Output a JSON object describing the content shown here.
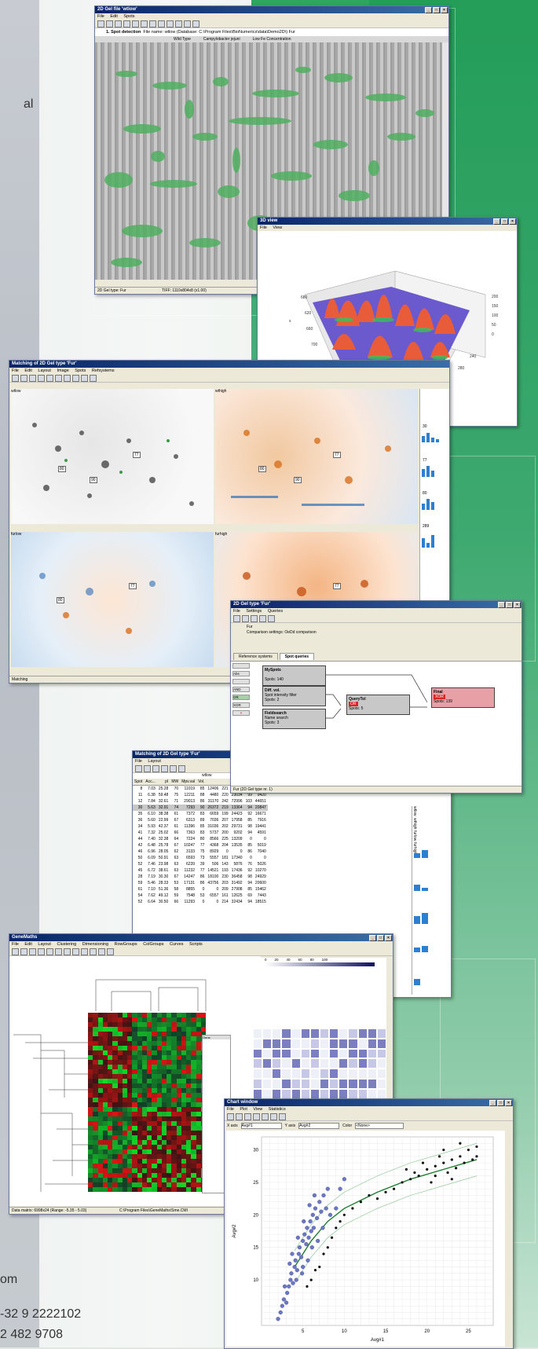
{
  "side_text": {
    "l1": "al",
    "l2": "om",
    "phone1": "-32 9 2222102",
    "phone2": "2 482 9708"
  },
  "gel_window": {
    "title": "2D Gel file 'wtlow'",
    "menu": [
      "File",
      "Edit",
      "Spots"
    ],
    "step": "1. Spot detection",
    "file_info": "File name: wtlow (Database: C:\\Program Files\\BioNumerics\\data\\Demo2D\\) Fur",
    "tabs": [
      "Wild Type",
      "Campylobacter jejuni",
      "Low Fe Concentration"
    ],
    "status_left": "2D Gel type: Fur",
    "status_right": "TIFF: 1110x804x8 (x1.00)"
  },
  "view3d": {
    "title": "3D view",
    "menu": [
      "File",
      "View"
    ],
    "y_ticks": [
      "200",
      "150",
      "100",
      "50",
      "0"
    ],
    "x_ticks": [
      "240",
      "280",
      "300",
      "320",
      "340",
      "260"
    ],
    "z_ticks": [
      "680",
      "620",
      "660",
      "700",
      "760"
    ],
    "axis_x": "x",
    "axis_y": "y"
  },
  "matching_window": {
    "title": "Matching of 2D Gel type 'Fur'",
    "menu": [
      "File",
      "Edit",
      "Layout",
      "Image",
      "Spots",
      "Refsystems"
    ],
    "panels": [
      "wtlow",
      "wthigh",
      "furlow",
      "furhigh"
    ],
    "spot_labels": [
      "77",
      "80",
      "90"
    ],
    "side_values": [
      "30",
      "77",
      "80",
      "289"
    ],
    "status": "Matching"
  },
  "query_window": {
    "title": "2D Gel type 'Fur'",
    "menu": [
      "File",
      "Settings",
      "Queries"
    ],
    "name": "Fur",
    "settings": "Comparison settings: OeDd comparison",
    "tabs": [
      "Reference systems",
      "Spot queries"
    ],
    "boxes": {
      "myspots": {
        "title": "MySpots",
        "sub": "Spots: 140"
      },
      "diff": {
        "title": "Diff. vol.",
        "sub1": "Spot intensity filter",
        "sub2": "Spots: 2"
      },
      "field": {
        "title": "Fieldsearch",
        "sub1": "Name search",
        "sub2": "Spots: 3"
      },
      "query": {
        "title": "QueryTol",
        "op": "OR",
        "sub": "Spots: 5"
      },
      "final": {
        "title": "Final",
        "op": "XOR",
        "sub": "Spots: 139"
      }
    },
    "left_btns": [
      "Abs",
      "AND",
      "OR",
      "XOR"
    ],
    "status": "Fur (2D Gel type nr. 1)"
  },
  "table_window": {
    "title": "Matching of 2D Gel type 'Fur'",
    "menu": [
      "File",
      "Layout"
    ],
    "group": "wtlow",
    "headers": [
      "Spot",
      "Acc...",
      "pI",
      "MW",
      "Mpv.val",
      "Vol.",
      "",
      "",
      "",
      "",
      ""
    ],
    "rows": [
      [
        "8",
        "7.03",
        "25.28",
        "70",
        "11019",
        "85",
        "12406",
        "221",
        "20874",
        "97",
        "11528"
      ],
      [
        "11",
        "6.38",
        "59.48",
        "75",
        "12211",
        "88",
        "4480",
        "220",
        "23034",
        "99",
        "9420"
      ],
      [
        "12",
        "7.84",
        "32.61",
        "71",
        "29013",
        "86",
        "31170",
        "242",
        "72996",
        "103",
        "44651"
      ],
      [
        "30",
        "5.63",
        "32.91",
        "74",
        "7293",
        "90",
        "26372",
        "219",
        "13364",
        "94",
        "20847"
      ],
      [
        "35",
        "6.10",
        "38.38",
        "61",
        "7372",
        "83",
        "6659",
        "199",
        "24423",
        "92",
        "16671"
      ],
      [
        "36",
        "5.60",
        "22.99",
        "67",
        "6313",
        "89",
        "7036",
        "207",
        "17958",
        "85",
        "7916"
      ],
      [
        "34",
        "5.93",
        "42.37",
        "61",
        "11396",
        "85",
        "31036",
        "202",
        "29731",
        "98",
        "19441"
      ],
      [
        "41",
        "7.32",
        "25.02",
        "66",
        "7363",
        "83",
        "5737",
        "200",
        "9202",
        "94",
        "4591"
      ],
      [
        "44",
        "7.40",
        "32.38",
        "64",
        "7224",
        "80",
        "8566",
        "225",
        "13209",
        "0",
        "0"
      ],
      [
        "42",
        "6.48",
        "25.78",
        "67",
        "10247",
        "77",
        "4368",
        "204",
        "13535",
        "85",
        "5019"
      ],
      [
        "46",
        "6.96",
        "28.05",
        "62",
        "3133",
        "75",
        "8929",
        "0",
        "0",
        "86",
        "7040"
      ],
      [
        "50",
        "6.09",
        "50.91",
        "63",
        "6593",
        "73",
        "5557",
        "181",
        "17340",
        "0",
        "0"
      ],
      [
        "52",
        "7.46",
        "23.98",
        "63",
        "6239",
        "39",
        "506",
        "143",
        "5876",
        "76",
        "5026"
      ],
      [
        "45",
        "6.72",
        "38.61",
        "63",
        "11232",
        "77",
        "14521",
        "193",
        "17436",
        "92",
        "10270"
      ],
      [
        "28",
        "7.19",
        "30.30",
        "67",
        "14247",
        "86",
        "18100",
        "230",
        "36458",
        "98",
        "24929"
      ],
      [
        "59",
        "5.46",
        "28.33",
        "53",
        "17131",
        "86",
        "43756",
        "203",
        "31492",
        "94",
        "20600"
      ],
      [
        "61",
        "7.10",
        "51.36",
        "58",
        "8855",
        "0",
        "0",
        "209",
        "27908",
        "85",
        "15462"
      ],
      [
        "54",
        "7.62",
        "49.12",
        "59",
        "7548",
        "53",
        "6557",
        "161",
        "12625",
        "69",
        "7443"
      ],
      [
        "52",
        "6.64",
        "30.50",
        "66",
        "11293",
        "0",
        "0",
        "214",
        "32434",
        "94",
        "18515"
      ]
    ],
    "right_labels": [
      "wtlow",
      "wthigh",
      "furlow",
      "furhigh"
    ]
  },
  "genemaths_window": {
    "title": "GeneMaths",
    "menu": [
      "File",
      "Edit",
      "Layout",
      "Clustering",
      "Dimensioning",
      "RowGroups",
      "ColGroups",
      "Curves",
      "Scripts"
    ],
    "gene_header": "Gene",
    "status_left": "Data matrix: 6998x24  (Range: -5.35 - 5.03)",
    "status_right": "C:\\Program Files\\GeneMaths\\Sme.CMI",
    "scale": [
      "0",
      "20",
      "40",
      "60",
      "80",
      "100"
    ]
  },
  "chart_window": {
    "title": "Chart window",
    "menu": [
      "File",
      "Plot",
      "View",
      "Statistics"
    ],
    "x_axis_label": "X axis",
    "x_axis_value": "Avg#1",
    "y_axis_label": "Y axis",
    "y_axis_value": "Avg#2",
    "color_label": "Color",
    "color_value": "<None>",
    "x_title": "Avg#1",
    "y_title": "Avg#2"
  },
  "chart_data": {
    "type": "scatter",
    "xlabel": "Avg#1",
    "ylabel": "Avg#2",
    "xlim": [
      0,
      28
    ],
    "ylim": [
      3,
      32
    ],
    "x_ticks": [
      5,
      10,
      15,
      20,
      25
    ],
    "y_ticks": [
      10,
      15,
      20,
      25,
      30
    ],
    "grid": true,
    "series": [
      {
        "name": "",
        "color": "#6c78c4",
        "points": [
          [
            2,
            4
          ],
          [
            2.3,
            5
          ],
          [
            2.5,
            6
          ],
          [
            2.7,
            7
          ],
          [
            3,
            6.5
          ],
          [
            3.1,
            8
          ],
          [
            3.3,
            9
          ],
          [
            3.5,
            10
          ],
          [
            3.6,
            11
          ],
          [
            3.8,
            9.5
          ],
          [
            4,
            12
          ],
          [
            4.1,
            13
          ],
          [
            4.3,
            11.5
          ],
          [
            4.5,
            14
          ],
          [
            4.6,
            15
          ],
          [
            4.8,
            13.5
          ],
          [
            5,
            16
          ],
          [
            5,
            12
          ],
          [
            5.2,
            17
          ],
          [
            5.4,
            15.5
          ],
          [
            5.5,
            18
          ],
          [
            5.7,
            16.5
          ],
          [
            5.9,
            19
          ],
          [
            6,
            17.5
          ],
          [
            6.2,
            20
          ],
          [
            6.3,
            18
          ],
          [
            6.5,
            21
          ],
          [
            6.7,
            19.5
          ],
          [
            7,
            22
          ],
          [
            7.2,
            20.5
          ],
          [
            7.5,
            23
          ],
          [
            7.8,
            21
          ],
          [
            8,
            24
          ],
          [
            3.7,
            14
          ],
          [
            4.4,
            16.5
          ],
          [
            5.1,
            19
          ],
          [
            5.8,
            21.5
          ],
          [
            6.4,
            23
          ],
          [
            2.8,
            9
          ],
          [
            3.4,
            12.5
          ],
          [
            4.2,
            10
          ],
          [
            4.9,
            11
          ],
          [
            5.6,
            13
          ],
          [
            6.1,
            15
          ],
          [
            6.8,
            16
          ],
          [
            7.4,
            18
          ],
          [
            8.3,
            20
          ],
          [
            9,
            21
          ],
          [
            9.5,
            24
          ],
          [
            10,
            25.5
          ]
        ]
      },
      {
        "name": "",
        "color": "#111111",
        "points": [
          [
            5.5,
            9
          ],
          [
            6,
            10
          ],
          [
            6.5,
            11.5
          ],
          [
            7,
            12
          ],
          [
            7.5,
            14
          ],
          [
            8,
            15
          ],
          [
            8.5,
            16.5
          ],
          [
            9,
            18
          ],
          [
            9.5,
            19
          ],
          [
            10,
            20
          ],
          [
            11,
            21
          ],
          [
            12,
            22
          ],
          [
            13,
            23
          ],
          [
            14,
            22.5
          ],
          [
            15,
            23.5
          ],
          [
            16,
            24
          ],
          [
            17,
            25
          ],
          [
            18,
            25.5
          ],
          [
            19,
            26
          ],
          [
            20,
            27
          ],
          [
            21,
            27.5
          ],
          [
            22,
            28
          ],
          [
            23,
            28.5
          ],
          [
            24,
            29
          ],
          [
            25,
            30
          ],
          [
            26,
            30.5
          ],
          [
            20.5,
            25
          ],
          [
            22.5,
            26.5
          ],
          [
            23.5,
            27.2
          ],
          [
            24.5,
            28
          ],
          [
            21.5,
            29
          ],
          [
            25.5,
            28.5
          ],
          [
            19.5,
            28
          ],
          [
            18.5,
            26.5
          ],
          [
            22,
            30
          ],
          [
            24,
            31
          ],
          [
            26,
            29
          ],
          [
            21,
            26
          ],
          [
            23,
            25.5
          ],
          [
            17.5,
            27
          ]
        ]
      }
    ],
    "fit_line": {
      "color": "#1e7d2e",
      "points": [
        [
          4,
          12
        ],
        [
          6,
          16
        ],
        [
          8,
          19
        ],
        [
          10,
          21
        ],
        [
          14,
          23.5
        ],
        [
          18,
          25.5
        ],
        [
          22,
          27
        ],
        [
          26,
          28.5
        ]
      ]
    }
  }
}
